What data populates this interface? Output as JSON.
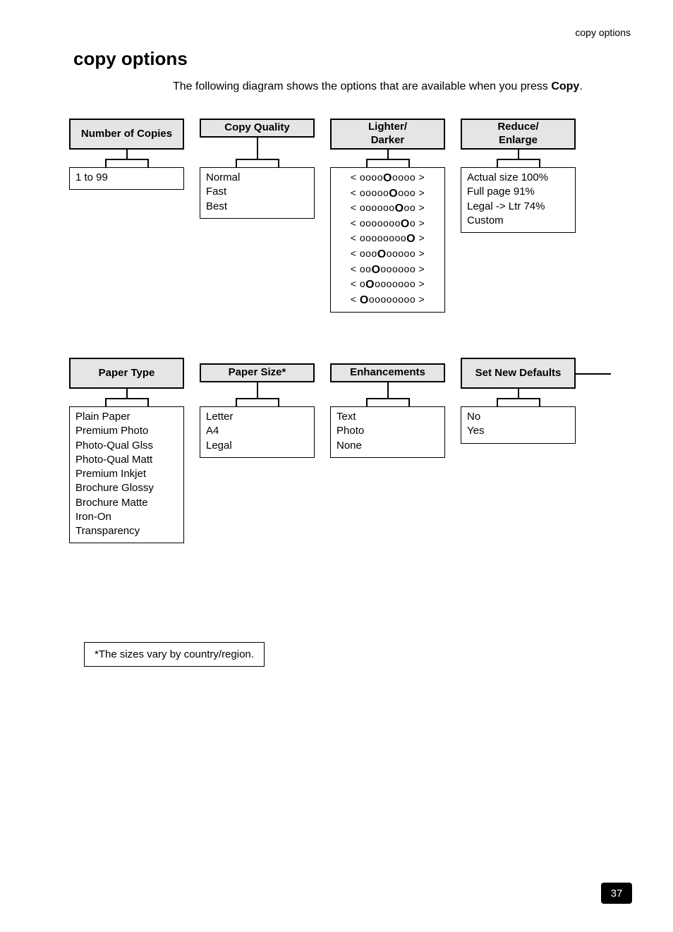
{
  "header_right": "copy options",
  "page_title": "copy options",
  "intro_text": "The following diagram shows the options that are available when you press ",
  "intro_bold": "Copy",
  "intro_tail": ".",
  "row1": {
    "number_of_copies": {
      "title": "Number of Copies",
      "options": [
        "1 to 99"
      ]
    },
    "copy_quality": {
      "title": "Copy Quality",
      "options": [
        "Normal",
        "Fast",
        "Best"
      ]
    },
    "lighter_darker": {
      "title": "Lighter/ Darker",
      "options": [
        "< oooo(O)oooo >",
        "< ooooo(O)ooo >",
        "< oooooo(O)oo >",
        "< ooooooo(O)o >",
        "< oooooooo(O) >",
        "< ooo(O)ooooo >",
        "< oo(O)oooooo >",
        "< o(O)ooooooo >",
        "< (O)oooooooo >"
      ]
    },
    "reduce_enlarge": {
      "title": "Reduce/ Enlarge",
      "options": [
        "Actual size 100%",
        "Full page 91%",
        "Legal -> Ltr 74%",
        "Custom"
      ]
    }
  },
  "row2": {
    "paper_type": {
      "title": "Paper Type",
      "options": [
        "Plain Paper",
        "Premium Photo",
        "Photo-Qual Glss",
        "Photo-Qual Matt",
        "Premium Inkjet",
        "Brochure Glossy",
        "Brochure Matte",
        "Iron-On",
        "Transparency"
      ]
    },
    "paper_size": {
      "title": "Paper Size*",
      "options": [
        "Letter",
        "A4",
        "Legal"
      ]
    },
    "enhancements": {
      "title": "Enhancements",
      "options": [
        "Text",
        "Photo",
        "None"
      ]
    },
    "set_new_defaults": {
      "title": "Set New Defaults",
      "options": [
        "No",
        "Yes"
      ]
    }
  },
  "footnote": "*The sizes vary by country/region.",
  "page_number": "37"
}
